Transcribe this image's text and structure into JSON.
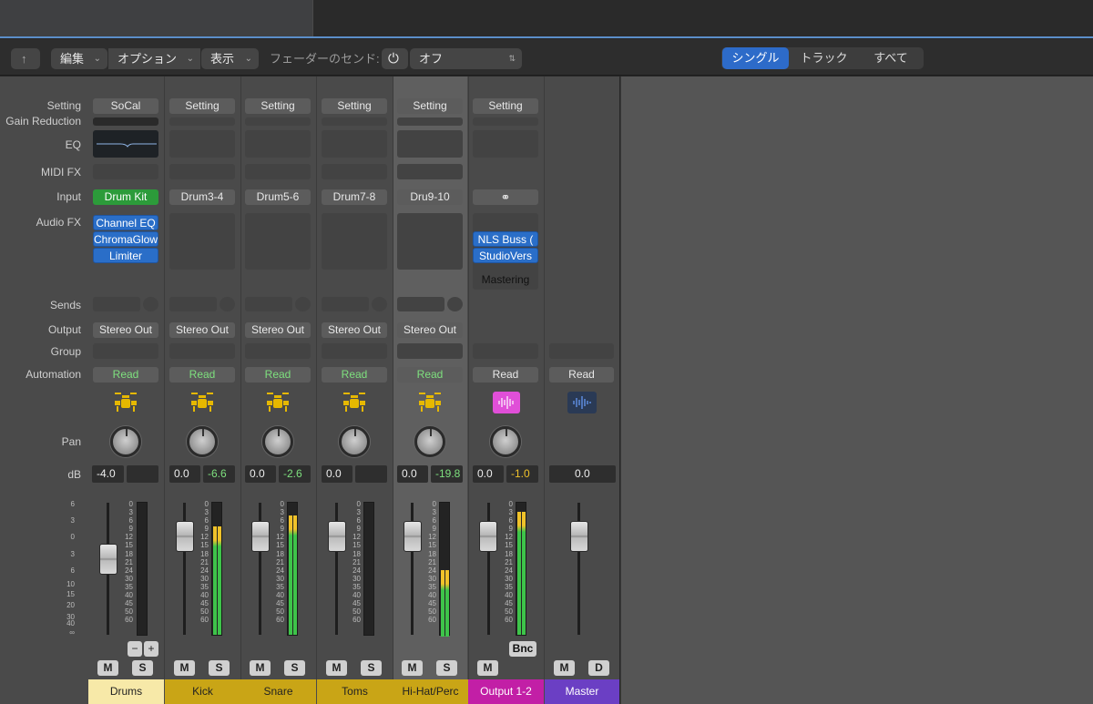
{
  "toolbar": {
    "back": "↑",
    "edit": "編集",
    "options": "オプション",
    "view": "表示",
    "sends_label": "フェーダーのセンド:",
    "sends_value": "オフ",
    "seg": [
      "シングル",
      "トラック",
      "すべて"
    ]
  },
  "labels": {
    "setting": "Setting",
    "gain": "Gain Reduction",
    "eq": "EQ",
    "midifx": "MIDI FX",
    "input": "Input",
    "audiofx": "Audio FX",
    "sends": "Sends",
    "output": "Output",
    "group": "Group",
    "automation": "Automation",
    "pan": "Pan",
    "db": "dB"
  },
  "strips": [
    {
      "name": "Drums",
      "setting": "SoCal",
      "input": "Drum Kit",
      "fx": [
        "Channel EQ",
        "ChromaGlow",
        "Limiter"
      ],
      "output": "Stereo Out",
      "auto": "Read",
      "vol": "-4.0",
      "peak": "",
      "mute": "M",
      "solo": "S",
      "color": "#f7e9a8"
    },
    {
      "name": "Kick",
      "setting": "Setting",
      "input": "Drum3-4",
      "fx": [],
      "output": "Stereo Out",
      "auto": "Read",
      "vol": "0.0",
      "peak": "-6.6",
      "mute": "M",
      "solo": "S",
      "color": "#c9a516"
    },
    {
      "name": "Snare",
      "setting": "Setting",
      "input": "Drum5-6",
      "fx": [],
      "output": "Stereo Out",
      "auto": "Read",
      "vol": "0.0",
      "peak": "-2.6",
      "mute": "M",
      "solo": "S",
      "color": "#c9a516"
    },
    {
      "name": "Toms",
      "setting": "Setting",
      "input": "Drum7-8",
      "fx": [],
      "output": "Stereo Out",
      "auto": "Read",
      "vol": "0.0",
      "peak": "",
      "mute": "M",
      "solo": "S",
      "color": "#c9a516"
    },
    {
      "name": "Hi-Hat/Perc",
      "setting": "Setting",
      "input": "Dru9-10",
      "fx": [],
      "output": "Stereo Out",
      "auto": "Read",
      "vol": "0.0",
      "peak": "-19.8",
      "mute": "M",
      "solo": "S",
      "color": "#c9a516"
    },
    {
      "name": "Output 1-2",
      "setting": "Setting",
      "input": "",
      "fx": [
        "NLS Buss (",
        "StudioVers"
      ],
      "fxgroup": "Mastering",
      "output": "",
      "auto": "Read",
      "vol": "0.0",
      "peak": "-1.0",
      "mute": "M",
      "bnc": "Bnc",
      "color": "#c21fa6"
    },
    {
      "name": "Master",
      "auto": "Read",
      "vol": "0.0",
      "mute": "M",
      "dim": "D",
      "color": "#6b3fc4"
    }
  ],
  "drum_buttons": {
    "minus": "−",
    "plus": "+"
  },
  "scale_left": [
    "6",
    "3",
    "0",
    "3",
    "6",
    "10",
    "15",
    "20",
    "30",
    "40",
    "∞"
  ],
  "scale_meter": [
    "0",
    "3",
    "6",
    "9",
    "12",
    "15",
    "18",
    "21",
    "24",
    "30",
    "35",
    "40",
    "45",
    "50",
    "60"
  ]
}
